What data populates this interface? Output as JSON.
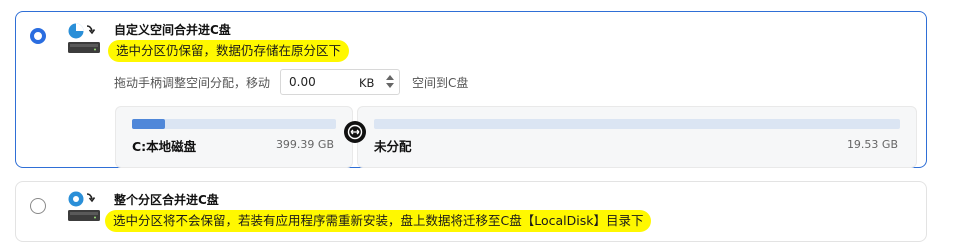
{
  "option_custom": {
    "title": "自定义空间合并进C盘",
    "note": "选中分区仍保留，数据仍存储在原分区下",
    "adjust_label": "拖动手柄调整空间分配，移动",
    "amount_value": "0.00",
    "amount_unit": "KB",
    "after_label": "空间到C盘",
    "left_partition": {
      "name": "C:本地磁盘",
      "size": "399.39 GB",
      "usage_fraction": 0.16
    },
    "right_partition": {
      "name": "未分配",
      "size": "19.53 GB",
      "usage_fraction": 0
    },
    "selected": true,
    "icon": "disk-merge-icon",
    "accent_color": "#2a6de0",
    "highlight_color": "#fff800"
  },
  "option_whole": {
    "title": "整个分区合并进C盘",
    "note": "选中分区将不会保留，若装有应用程序需重新安装，盘上数据将迁移至C盘【LocalDisk】目录下",
    "selected": false,
    "icon": "disk-merge-icon"
  }
}
